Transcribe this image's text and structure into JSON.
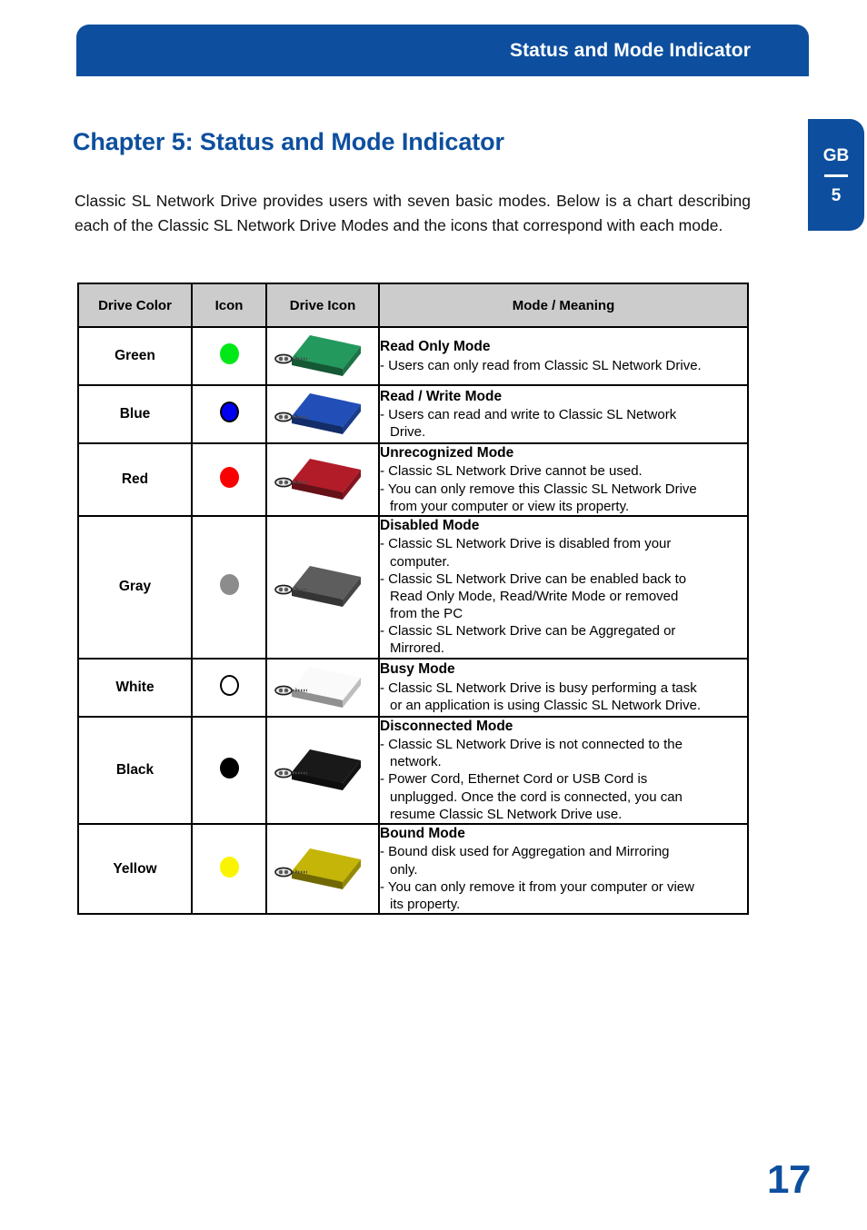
{
  "header": {
    "running_head": "Status and Mode Indicator",
    "accent_color": "#0d4f9e"
  },
  "side_tab": {
    "language": "GB",
    "chapter_number": "5"
  },
  "chapter": {
    "title": "Chapter 5: Status and Mode Indicator",
    "intro": "Classic SL Network Drive provides users with seven basic modes. Below is a chart describing each of the Classic SL Network Drive Modes and the icons that correspond with each mode."
  },
  "table": {
    "headers": [
      "Drive Color",
      "Icon",
      "Drive Icon",
      "Mode / Meaning"
    ],
    "header_background": "#cccccc",
    "rows": [
      {
        "drive_color": "Green",
        "led_color": "#00e818",
        "drive_icon_color": "#1d7a4a",
        "mode_name": "Read Only Mode",
        "lines": [
          "- Users can only read from Classic SL Network Drive."
        ]
      },
      {
        "drive_color": "Blue",
        "led_color": "#0000ee",
        "drive_icon_color": "#1b3f92",
        "mode_name": "Read / Write Mode",
        "lines": [
          "- Users can read and write to Classic SL Network\n   Drive."
        ]
      },
      {
        "drive_color": "Red",
        "led_color": "#fa0000",
        "drive_icon_color": "#8e1621",
        "mode_name": "Unrecognized Mode",
        "lines": [
          "- Classic SL Network Drive cannot be used.",
          "- You can only remove this Classic SL Network Drive\n   from your computer or view its property."
        ]
      },
      {
        "drive_color": "Gray",
        "led_color": "#8c8c8c",
        "drive_icon_color": "#4a4a4a",
        "mode_name": "Disabled Mode",
        "lines": [
          "- Classic SL Network Drive is disabled from your\n   computer.",
          "- Classic SL Network Drive can be enabled back to\n   Read Only Mode, Read/Write Mode or removed\n   from the PC",
          "- Classic SL Network Drive can be Aggregated or\n   Mirrored."
        ]
      },
      {
        "drive_color": "White",
        "led_color": "#ffffff",
        "drive_icon_color": "#c8c8c8",
        "mode_name": "Busy Mode",
        "lines": [
          "- Classic SL Network Drive is busy performing a task\n   or an application is using Classic SL Network Drive."
        ]
      },
      {
        "drive_color": "Black",
        "led_color": "#000000",
        "drive_icon_color": "#141414",
        "mode_name": "Disconnected Mode",
        "lines": [
          "- Classic SL Network Drive is not connected to the\n   network.",
          "- Power Cord, Ethernet Cord or USB Cord is\n   unplugged.  Once the cord is connected, you can\n   resume Classic SL Network Drive use."
        ]
      },
      {
        "drive_color": "Yellow",
        "led_color": "#fbf400",
        "drive_icon_color": "#9d9106",
        "mode_name": "Bound Mode",
        "lines": [
          "- Bound disk used for Aggregation and Mirroring\n   only.",
          "- You can only remove it from your computer or view\n   its property."
        ]
      }
    ]
  },
  "footer": {
    "page_number": "17"
  }
}
